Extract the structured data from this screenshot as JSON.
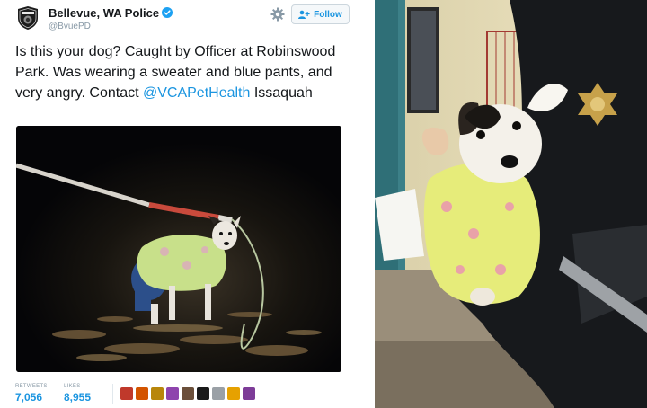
{
  "tweet": {
    "author": {
      "name": "Bellevue, WA Police",
      "handle": "@BvuePD",
      "verified": true
    },
    "follow_label": "Follow",
    "text_before": "Is this your dog? Caught by Officer at Robinswood Park. Was wearing a sweater and blue pants, and very angry. Contact ",
    "mention": "@VCAPetHealth",
    "text_after": " Issaquah",
    "stats": {
      "retweets_label": "RETWEETS",
      "retweets_value": "7,056",
      "likes_label": "LIKES",
      "likes_value": "8,955"
    },
    "liker_colors": [
      "#c0392b",
      "#d35400",
      "#b8860b",
      "#8e44ad",
      "#6b4f3a",
      "#1a1a1a",
      "#9aa0a6",
      "#e6a100",
      "#7d3c98"
    ]
  },
  "icons": {
    "avatar": "police-badge-icon",
    "verified": "verified-check-icon",
    "settings": "gear-icon",
    "follow": "add-user-icon"
  },
  "colors": {
    "accent": "#1b95e0",
    "text": "#14171a",
    "muted": "#8899a6"
  }
}
